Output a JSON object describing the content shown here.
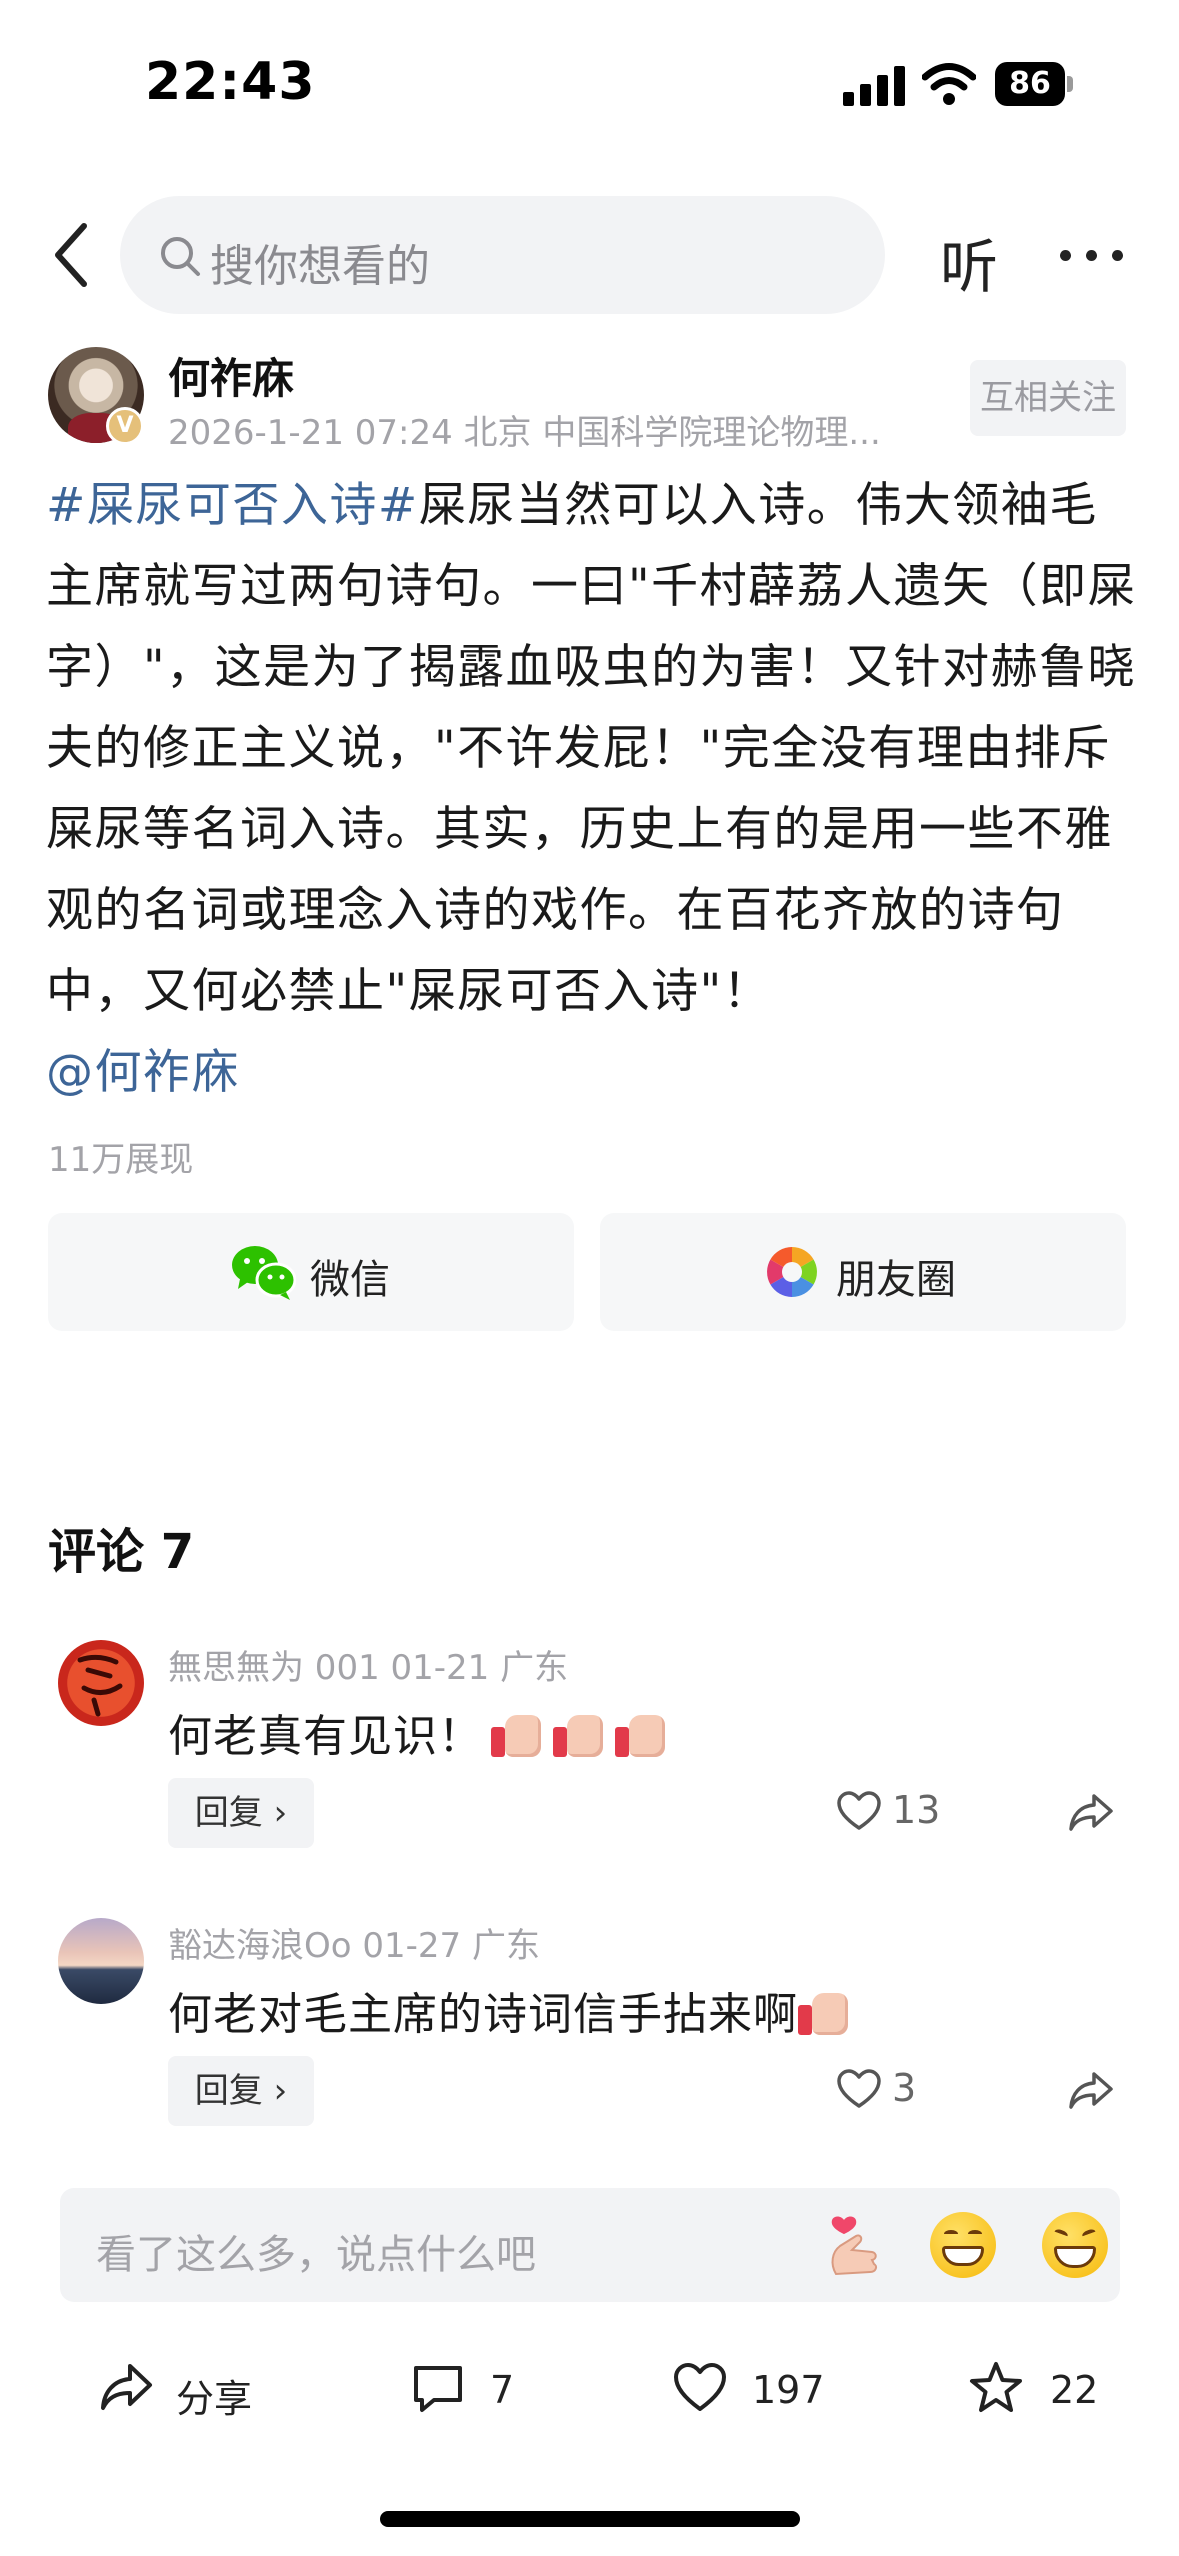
{
  "status_bar": {
    "time": "22:43",
    "battery": "86"
  },
  "nav": {
    "search_placeholder": "搜你想看的",
    "listen_label": "听"
  },
  "post": {
    "author_name": "何祚庥",
    "verify_badge": "V",
    "meta": "2026-1-21 07:24  北京  中国科学院理论物理...",
    "follow_label": "互相关注",
    "hashtag": "#屎尿可否入诗#",
    "body": "屎尿当然可以入诗。伟大领袖毛主席就写过两句诗句。一曰\"千村薜荔人遗矢（即屎字）\"，这是为了揭露血吸虫的为害！又针对赫鲁晓夫的修正主义说，\"不许发屁！\"完全没有理由排斥屎尿等名词入诗。其实，历史上有的是用一些不雅观的名词或理念入诗的戏作。在百花齐放的诗句中，又何必禁止\"屎尿可否入诗\"！",
    "mention": "@何祚庥",
    "view_count": "11万展现"
  },
  "share": {
    "wechat_label": "微信",
    "moments_label": "朋友圈"
  },
  "comments": {
    "title": "评论 7",
    "items": [
      {
        "author": "無思無为 001   01-21  广东",
        "text": "何老真有见识！",
        "emoji_count": 3,
        "reply_label": "回复 ›",
        "likes": "13"
      },
      {
        "author": "豁达海浪Oo   01-27  广东",
        "text": "何老对毛主席的诗词信手拈来啊",
        "emoji_count": 1,
        "reply_label": "回复 ›",
        "likes": "3"
      }
    ]
  },
  "comment_input": {
    "placeholder": "看了这么多，说点什么吧"
  },
  "toolbar": {
    "share_label": "分享",
    "comment_count": "7",
    "like_count": "197",
    "favorite_count": "22"
  },
  "colors": {
    "link": "#3d6597",
    "wechat_green": "#2dc100",
    "secondary_text": "#a3a3a8"
  },
  "icons": [
    "back-icon",
    "search-icon",
    "more-icon",
    "wechat-icon",
    "moments-icon",
    "thumbs-up-icon",
    "like-icon",
    "forward-icon",
    "heart-hand-icon",
    "grin-icon",
    "laugh-icon",
    "share-icon",
    "comment-icon",
    "heart-icon",
    "star-icon"
  ]
}
